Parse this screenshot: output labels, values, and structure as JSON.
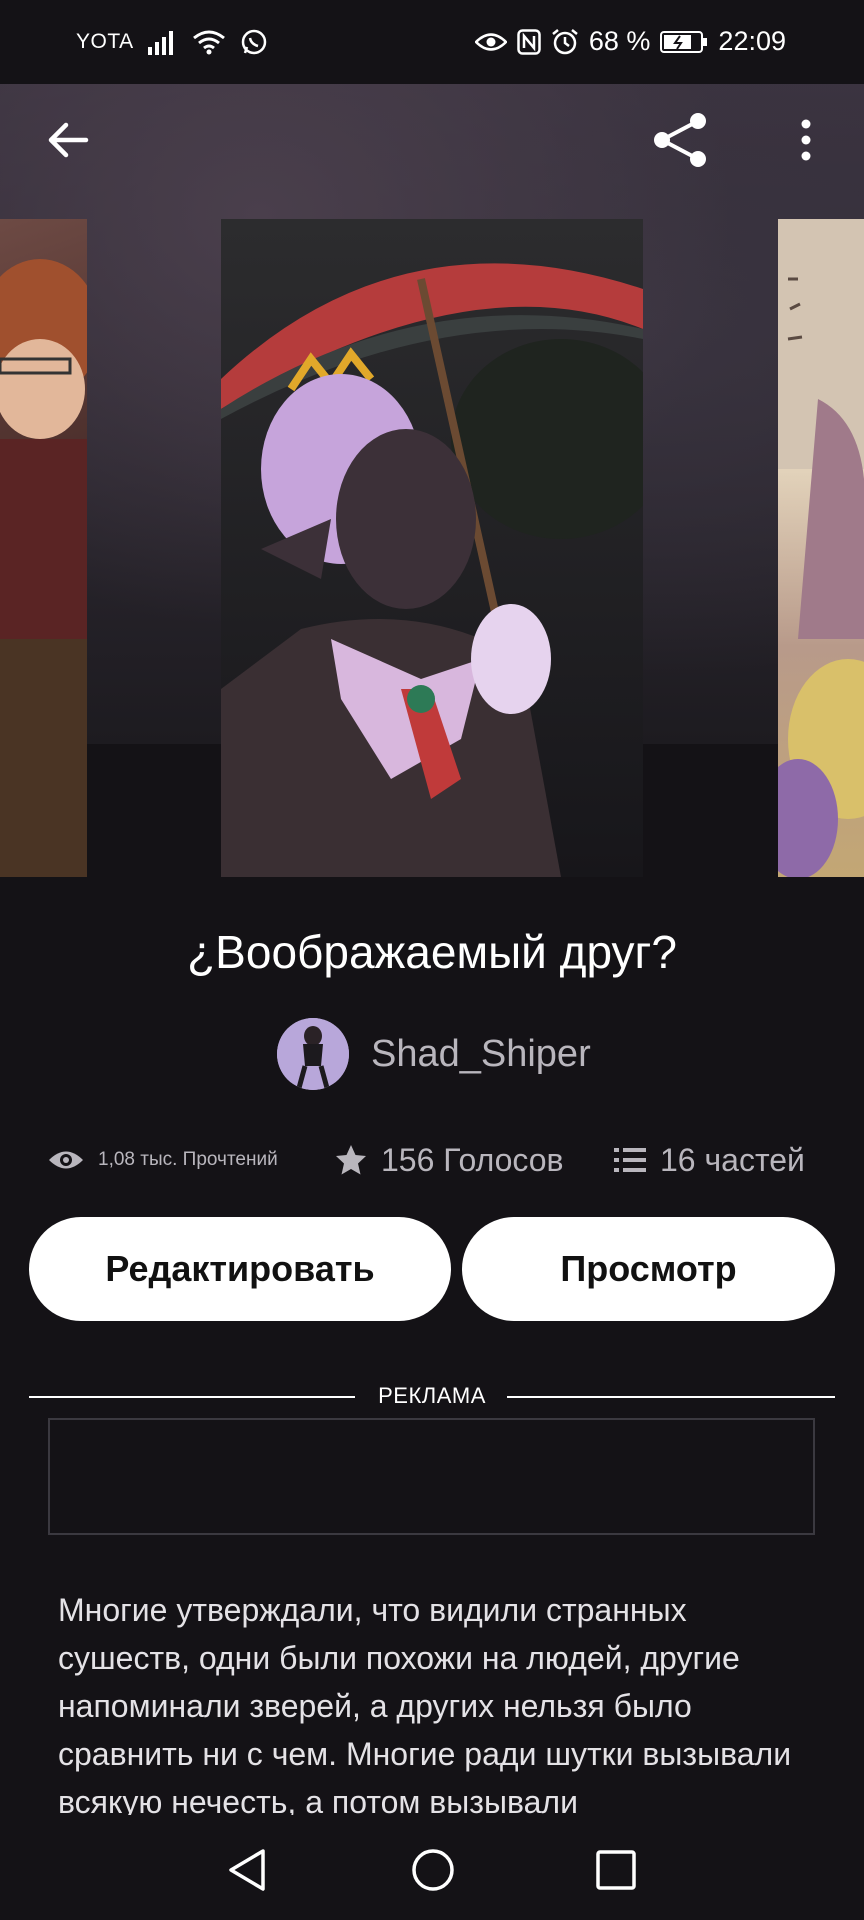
{
  "status_bar": {
    "carrier": "YOTA",
    "battery_percent": "68 %",
    "time": "22:09"
  },
  "header": {
    "back_icon": "arrow-left-icon",
    "share_icon": "share-icon",
    "menu_icon": "more-vertical-icon"
  },
  "story": {
    "title": "¿Воображаемый друг?",
    "author": "Shad_Shiper",
    "reads": "1,08 тыс. Прочтений",
    "votes": "156 Голосов",
    "parts": "16 частей"
  },
  "actions": {
    "edit_label": "Редактировать",
    "view_label": "Просмотр"
  },
  "ad": {
    "label": "РЕКЛАМА"
  },
  "description": "Многие утверждали, что видили странных сушеств, одни были похожи на людей, другие напоминали зверей, а других нельзя было сравнить ни с чем. Многие ради шутки вызывали всякую нечесть, а потом вызывали",
  "colors": {
    "background": "#141216",
    "button": "#ffffff",
    "muted_text": "#b9b6bd"
  }
}
